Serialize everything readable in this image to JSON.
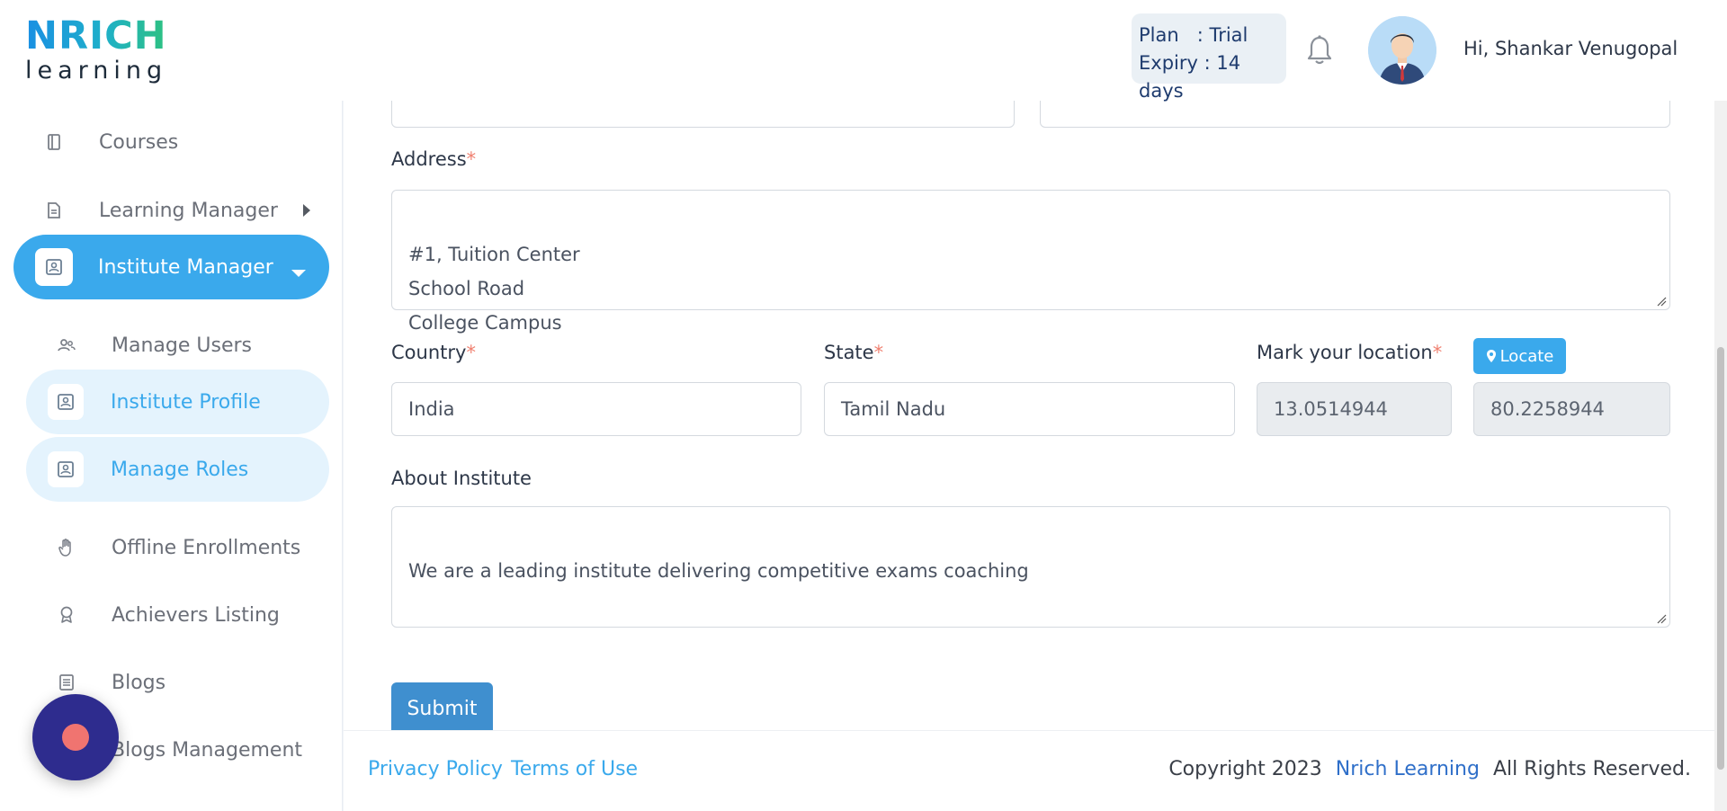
{
  "header": {
    "logo_brand": "NRICH",
    "logo_sub": "learning",
    "plan_line": "Plan   : Trial",
    "expiry_line": "Expiry : 14 days",
    "greeting": "Hi, Shankar Venugopal"
  },
  "sidebar": {
    "items": [
      {
        "label": "Courses",
        "icon": "book-icon"
      },
      {
        "label": "Learning Manager",
        "icon": "document-icon"
      },
      {
        "label": "Institute Manager",
        "icon": "id-card-icon"
      },
      {
        "label": "Manage Users",
        "icon": "users-icon"
      },
      {
        "label": "Institute Profile",
        "icon": "id-card-icon"
      },
      {
        "label": "Manage Roles",
        "icon": "id-card-icon"
      },
      {
        "label": "Offline Enrollments",
        "icon": "hand-icon"
      },
      {
        "label": "Achievers Listing",
        "icon": "award-icon"
      },
      {
        "label": "Blogs",
        "icon": "list-icon"
      },
      {
        "label": "Blogs Management",
        "icon": "list-icon"
      }
    ]
  },
  "form": {
    "address_label": "Address",
    "address_value": "#1, Tuition Center\nSchool Road\nCollege Campus",
    "country_label": "Country",
    "country_value": "India",
    "state_label": "State",
    "state_value": "Tamil Nadu",
    "location_label": "Mark your location",
    "locate_button": "Locate",
    "latitude": "13.0514944",
    "longitude": "80.2258944",
    "about_label": "About Institute",
    "about_value": "We are a leading institute delivering competitive exams coaching",
    "required_mark": "*",
    "submit_label": "Submit"
  },
  "footer": {
    "privacy": "Privacy Policy",
    "terms": "Terms of Use",
    "copyright_prefix": "Copyright 2023",
    "copyright_brand": "Nrich Learning",
    "copyright_suffix": "All Rights Reserved."
  },
  "colors": {
    "accent": "#3aa9ec",
    "submit": "#3f8fcf",
    "fab": "#2e2c8e",
    "required": "#f08070"
  }
}
